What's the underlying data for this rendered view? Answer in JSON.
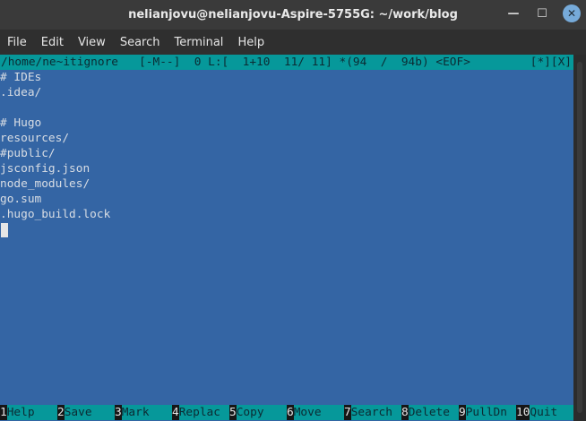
{
  "window": {
    "title": "nelianjovu@nelianjovu-Aspire-5755G: ~/work/blog",
    "minimize_glyph": "—",
    "maximize_glyph": "☐",
    "close_glyph": "✕"
  },
  "menubar": {
    "items": [
      "File",
      "Edit",
      "View",
      "Search",
      "Terminal",
      "Help"
    ]
  },
  "editor": {
    "status_left": "/home/ne~itignore   [-M--]  0 L:[  1+10  11/ 11] *(94  /  94b) <EOF>",
    "status_right": "[*][X]",
    "lines": [
      "# IDEs",
      ".idea/",
      "",
      "# Hugo",
      "resources/",
      "#public/",
      "jsconfig.json",
      "node_modules/",
      "go.sum",
      ".hugo_build.lock"
    ]
  },
  "function_keys": [
    {
      "num": "1",
      "label": "Help"
    },
    {
      "num": "2",
      "label": "Save"
    },
    {
      "num": "3",
      "label": "Mark"
    },
    {
      "num": "4",
      "label": "Replac"
    },
    {
      "num": "5",
      "label": "Copy"
    },
    {
      "num": "6",
      "label": "Move"
    },
    {
      "num": "7",
      "label": "Search"
    },
    {
      "num": "8",
      "label": "Delete"
    },
    {
      "num": "9",
      "label": "PullDn"
    },
    {
      "num": "10",
      "label": "Quit"
    }
  ],
  "colors": {
    "editor_bg": "#3465a4",
    "status_bg": "#06989a",
    "text": "#d8dde4"
  }
}
